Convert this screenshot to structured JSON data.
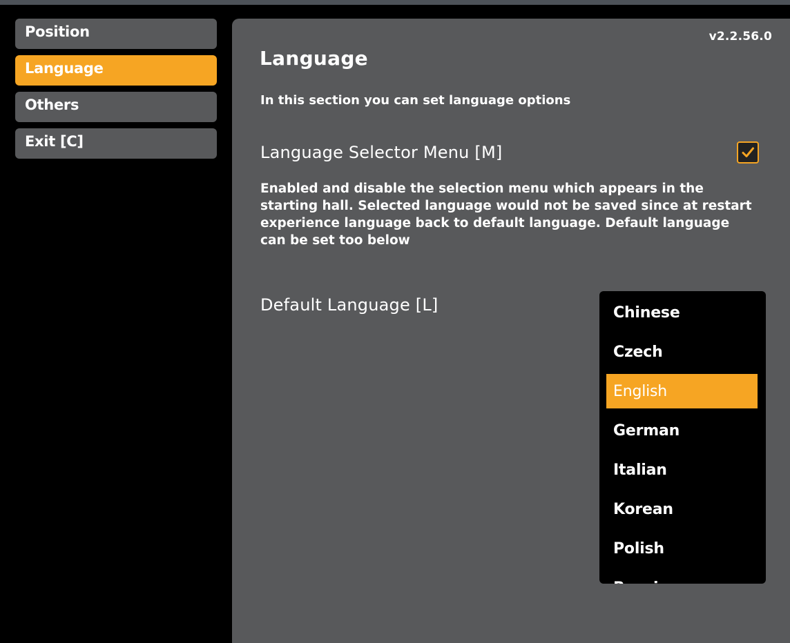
{
  "sidebar": {
    "items": [
      {
        "label": "Position"
      },
      {
        "label": "Language"
      },
      {
        "label": "Others"
      },
      {
        "label": "Exit [C]"
      }
    ]
  },
  "panel": {
    "version": "v2.2.56.0",
    "title": "Language",
    "description": "In this section you can set language options",
    "selector_menu": {
      "label": "Language Selector Menu [M]",
      "checked": true,
      "description": "Enabled and disable the selection menu which appears in the starting hall. Selected language would not be saved since at restart experience language back to default language. Default language can be set too below"
    },
    "default_language": {
      "label": "Default Language [L]",
      "selected": "English",
      "options": [
        "Chinese",
        "Czech",
        "English",
        "German",
        "Italian",
        "Korean",
        "Polish",
        "Russian"
      ]
    }
  },
  "colors": {
    "accent": "#f6a523",
    "panel_bg": "#58595b",
    "background": "#000000"
  }
}
